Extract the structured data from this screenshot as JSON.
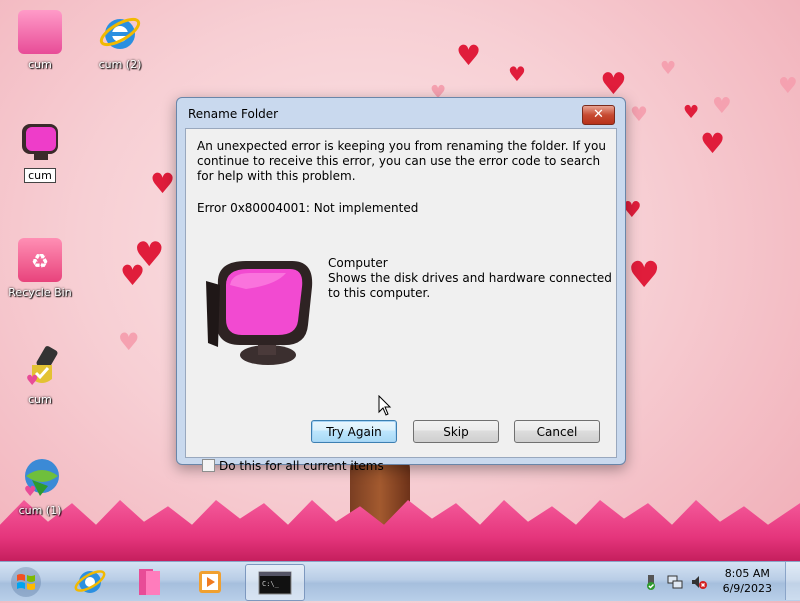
{
  "desktop": {
    "icons": [
      {
        "label": "cum",
        "icon": "pink-folder-icon"
      },
      {
        "label": "cum (2)",
        "icon": "internet-explorer-icon"
      },
      {
        "label": "cum",
        "icon": "computer-monitor-icon"
      },
      {
        "label": "Recycle Bin",
        "icon": "recycle-bin-icon"
      },
      {
        "label": "cum",
        "icon": "usb-drive-icon"
      },
      {
        "label": "cum (1)",
        "icon": "download-manager-icon"
      }
    ]
  },
  "dialog": {
    "title": "Rename Folder",
    "close_label": "✕",
    "message": "An unexpected error is keeping you from renaming the folder. If you continue to receive this error, you can use the error code to search for help with this problem.",
    "error": "Error 0x80004001: Not implemented",
    "item_name": "Computer",
    "item_description": "Shows the disk drives and hardware connected to this computer.",
    "buttons": {
      "try_again": "Try Again",
      "skip": "Skip",
      "cancel": "Cancel"
    },
    "checkbox_label": "Do this for all current items"
  },
  "taskbar": {
    "pinned": [
      "start-orb",
      "internet-explorer",
      "pink-folder",
      "media-player",
      "command-prompt"
    ],
    "clock": {
      "time": "8:05 AM",
      "date": "6/9/2023"
    }
  },
  "colors": {
    "accent": "#e84c97",
    "heart": "#e01d3b",
    "taskbar": "#b9cde6"
  }
}
